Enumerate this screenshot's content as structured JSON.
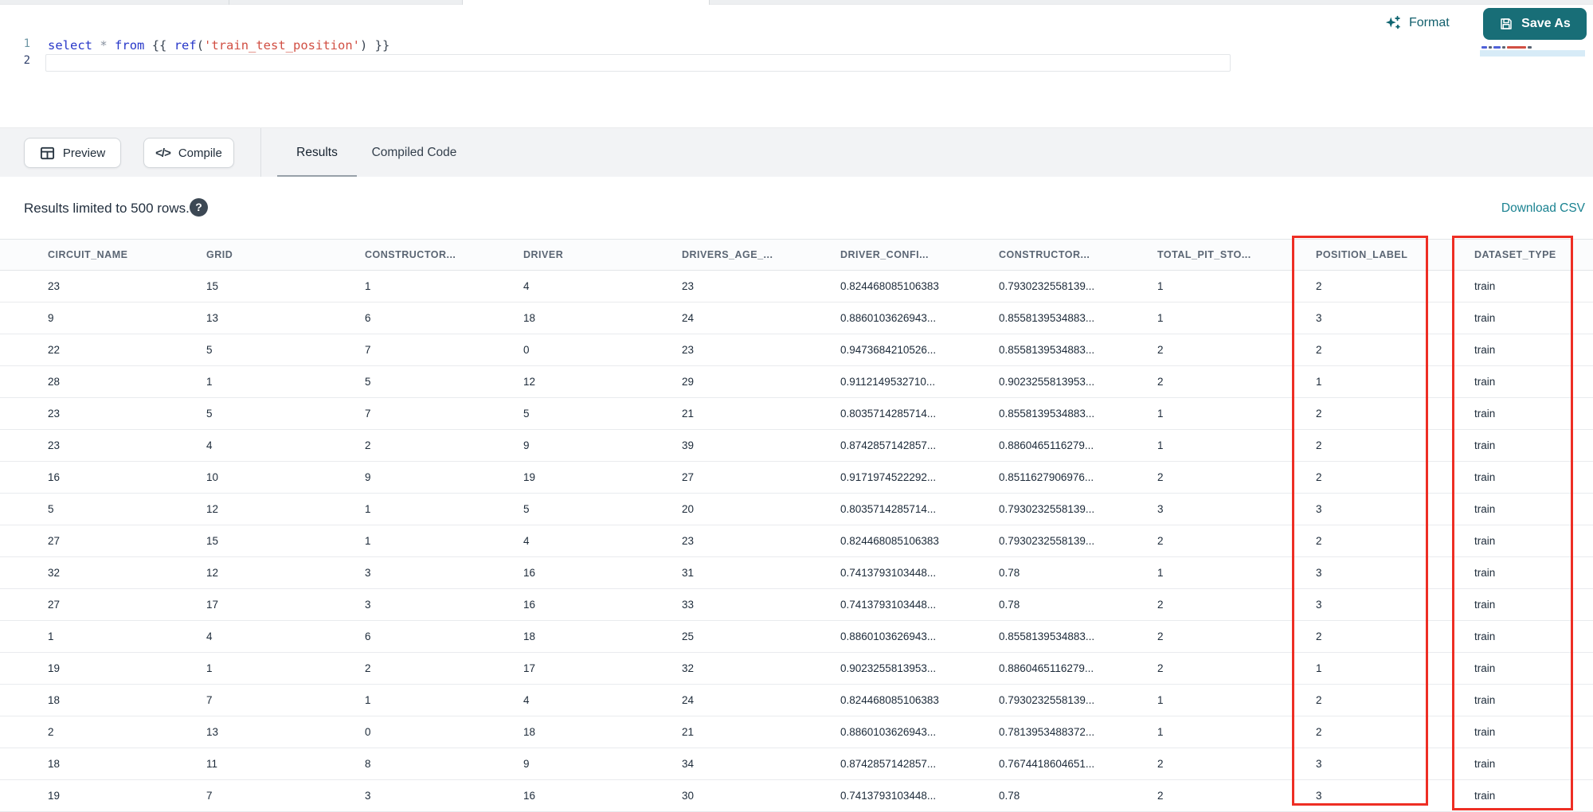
{
  "colors": {
    "accent_teal": "#186e77",
    "highlight_red": "#ee2e24",
    "link_teal": "#1a8291"
  },
  "top_bar": {
    "format_label": "Format",
    "save_as_label": "Save As"
  },
  "editor": {
    "line_numbers": [
      "1",
      "2"
    ],
    "code_text": "select * from {{ ref('train_test_position') }}",
    "tokens": [
      {
        "text": "select",
        "color": "#2838c9"
      },
      {
        "text": " ",
        "color": "#3a4553"
      },
      {
        "text": "*",
        "color": "#8892a0"
      },
      {
        "text": " ",
        "color": "#3a4553"
      },
      {
        "text": "from",
        "color": "#2838c9"
      },
      {
        "text": " {{ ",
        "color": "#3a4553"
      },
      {
        "text": "ref",
        "color": "#2838c9"
      },
      {
        "text": "(",
        "color": "#3a4553"
      },
      {
        "text": "'train_test_position'",
        "color": "#d14f43"
      },
      {
        "text": ")",
        "color": "#3a4553"
      },
      {
        "text": " }}",
        "color": "#3a4553"
      }
    ]
  },
  "toolbar": {
    "preview_label": "Preview",
    "compile_label": "Compile",
    "tabs": [
      {
        "label": "Results",
        "active": true
      },
      {
        "label": "Compiled Code",
        "active": false
      }
    ]
  },
  "icons": {
    "compile_glyph": "</>",
    "help_glyph": "?"
  },
  "results_bar": {
    "message": "Results limited to 500 rows.",
    "download_label": "Download CSV"
  },
  "table": {
    "columns": [
      "CIRCUIT_NAME",
      "GRID",
      "CONSTRUCTOR...",
      "DRIVER",
      "DRIVERS_AGE_...",
      "DRIVER_CONFI...",
      "CONSTRUCTOR...",
      "TOTAL_PIT_STO...",
      "POSITION_LABEL",
      "DATASET_TYPE"
    ],
    "highlighted_columns": [
      "POSITION_LABEL",
      "DATASET_TYPE"
    ],
    "rows": [
      [
        "23",
        "15",
        "1",
        "4",
        "23",
        "0.824468085106383",
        "0.7930232558139...",
        "1",
        "2",
        "train"
      ],
      [
        "9",
        "13",
        "6",
        "18",
        "24",
        "0.8860103626943...",
        "0.8558139534883...",
        "1",
        "3",
        "train"
      ],
      [
        "22",
        "5",
        "7",
        "0",
        "23",
        "0.9473684210526...",
        "0.8558139534883...",
        "2",
        "2",
        "train"
      ],
      [
        "28",
        "1",
        "5",
        "12",
        "29",
        "0.9112149532710...",
        "0.9023255813953...",
        "2",
        "1",
        "train"
      ],
      [
        "23",
        "5",
        "7",
        "5",
        "21",
        "0.8035714285714...",
        "0.8558139534883...",
        "1",
        "2",
        "train"
      ],
      [
        "23",
        "4",
        "2",
        "9",
        "39",
        "0.8742857142857...",
        "0.8860465116279...",
        "1",
        "2",
        "train"
      ],
      [
        "16",
        "10",
        "9",
        "19",
        "27",
        "0.9171974522292...",
        "0.8511627906976...",
        "2",
        "2",
        "train"
      ],
      [
        "5",
        "12",
        "1",
        "5",
        "20",
        "0.8035714285714...",
        "0.7930232558139...",
        "3",
        "3",
        "train"
      ],
      [
        "27",
        "15",
        "1",
        "4",
        "23",
        "0.824468085106383",
        "0.7930232558139...",
        "2",
        "2",
        "train"
      ],
      [
        "32",
        "12",
        "3",
        "16",
        "31",
        "0.7413793103448...",
        "0.78",
        "1",
        "3",
        "train"
      ],
      [
        "27",
        "17",
        "3",
        "16",
        "33",
        "0.7413793103448...",
        "0.78",
        "2",
        "3",
        "train"
      ],
      [
        "1",
        "4",
        "6",
        "18",
        "25",
        "0.8860103626943...",
        "0.8558139534883...",
        "2",
        "2",
        "train"
      ],
      [
        "19",
        "1",
        "2",
        "17",
        "32",
        "0.9023255813953...",
        "0.8860465116279...",
        "2",
        "1",
        "train"
      ],
      [
        "18",
        "7",
        "1",
        "4",
        "24",
        "0.824468085106383",
        "0.7930232558139...",
        "1",
        "2",
        "train"
      ],
      [
        "2",
        "13",
        "0",
        "18",
        "21",
        "0.8860103626943...",
        "0.7813953488372...",
        "1",
        "2",
        "train"
      ],
      [
        "18",
        "11",
        "8",
        "9",
        "34",
        "0.8742857142857...",
        "0.7674418604651...",
        "2",
        "3",
        "train"
      ],
      [
        "19",
        "7",
        "3",
        "16",
        "30",
        "0.7413793103448...",
        "0.78",
        "2",
        "3",
        "train"
      ]
    ]
  }
}
